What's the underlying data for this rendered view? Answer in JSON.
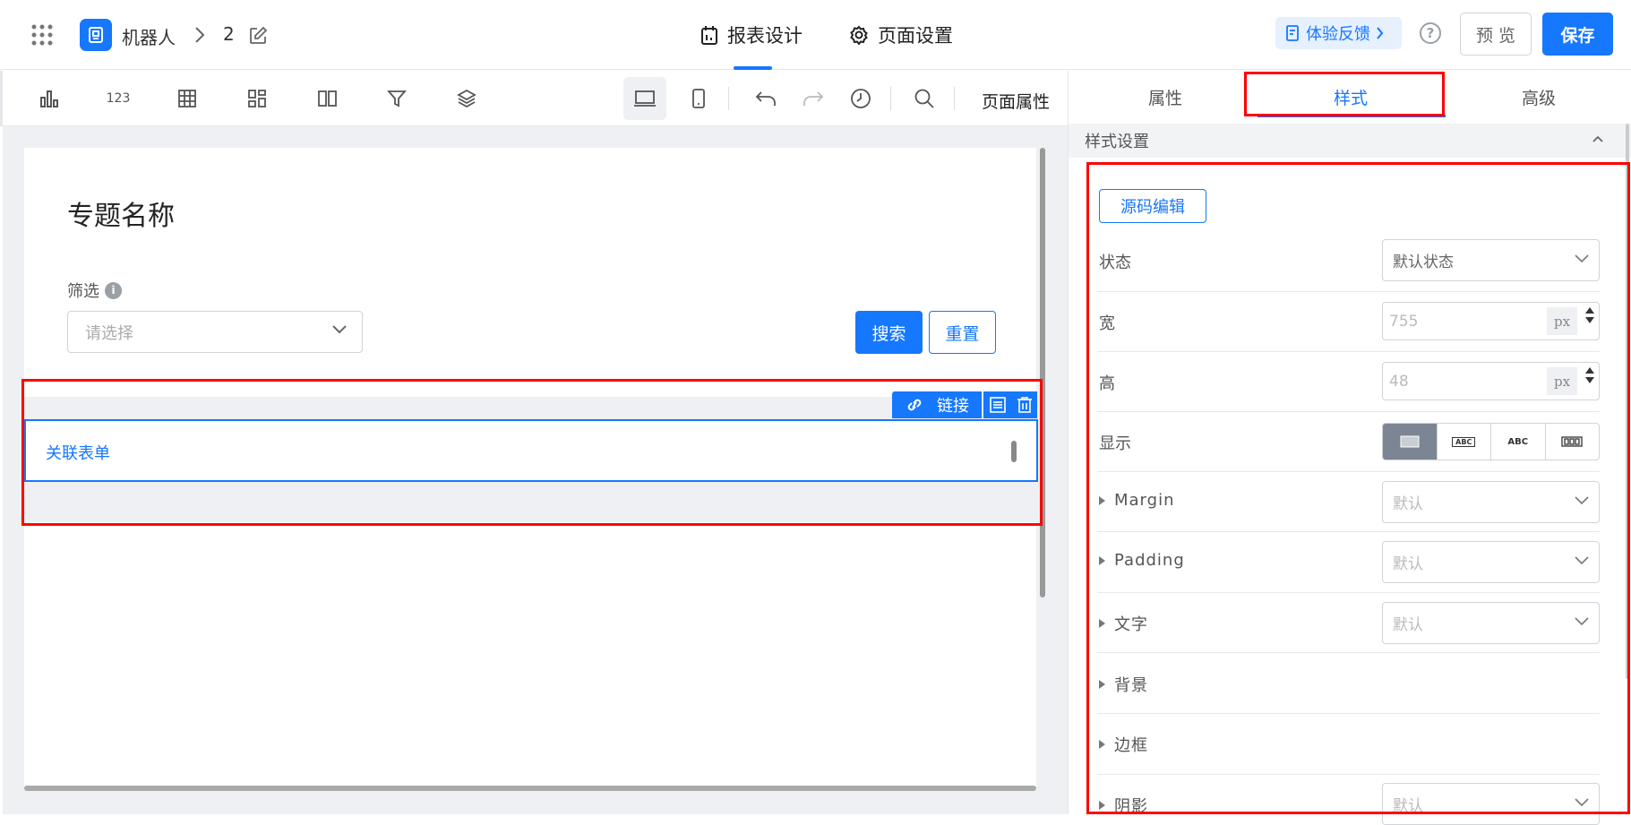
{
  "header": {
    "app_name": "机器人",
    "version": "2",
    "tabs": [
      {
        "label": "报表设计",
        "active": true
      },
      {
        "label": "页面设置",
        "active": false
      }
    ],
    "feedback_label": "体验反馈",
    "help_glyph": "?",
    "preview_label": "预 览",
    "save_label": "保存",
    "accent_color": "#1677ff"
  },
  "toolbar": {
    "icons": [
      "bar-chart-icon",
      "number-icon",
      "table-icon",
      "grid-icon",
      "columns-icon",
      "filter-icon",
      "layers-icon",
      "desktop-icon",
      "mobile-icon",
      "undo-icon",
      "redo-icon",
      "history-icon",
      "search-icon"
    ],
    "number_glyph": "123",
    "page_props_label": "页面属性"
  },
  "canvas": {
    "page_title": "专题名称",
    "filter_label": "筛选",
    "filter_info": "i",
    "select_placeholder": "请选择",
    "search_label": "搜索",
    "reset_label": "重置",
    "component_label": "关联表单",
    "link_label": "链接"
  },
  "panel": {
    "tabs": [
      {
        "label": "属性",
        "active": false
      },
      {
        "label": "样式",
        "active": true
      },
      {
        "label": "高级",
        "active": false
      }
    ],
    "section_title": "样式设置",
    "code_edit_label": "源码编辑",
    "status_label": "状态",
    "status_value": "默认状态",
    "width_label": "宽",
    "width_value": "755",
    "height_label": "高",
    "height_value": "48",
    "unit": "px",
    "display_label": "显示",
    "display_options": [
      "",
      "ABC",
      "ABC",
      ""
    ],
    "margin_label": "Margin",
    "padding_label": "Padding",
    "text_label": "文字",
    "background_label": "背景",
    "border_label": "边框",
    "shadow_label": "阴影",
    "default_value": "默认"
  },
  "highlight_color": "#ff0000"
}
